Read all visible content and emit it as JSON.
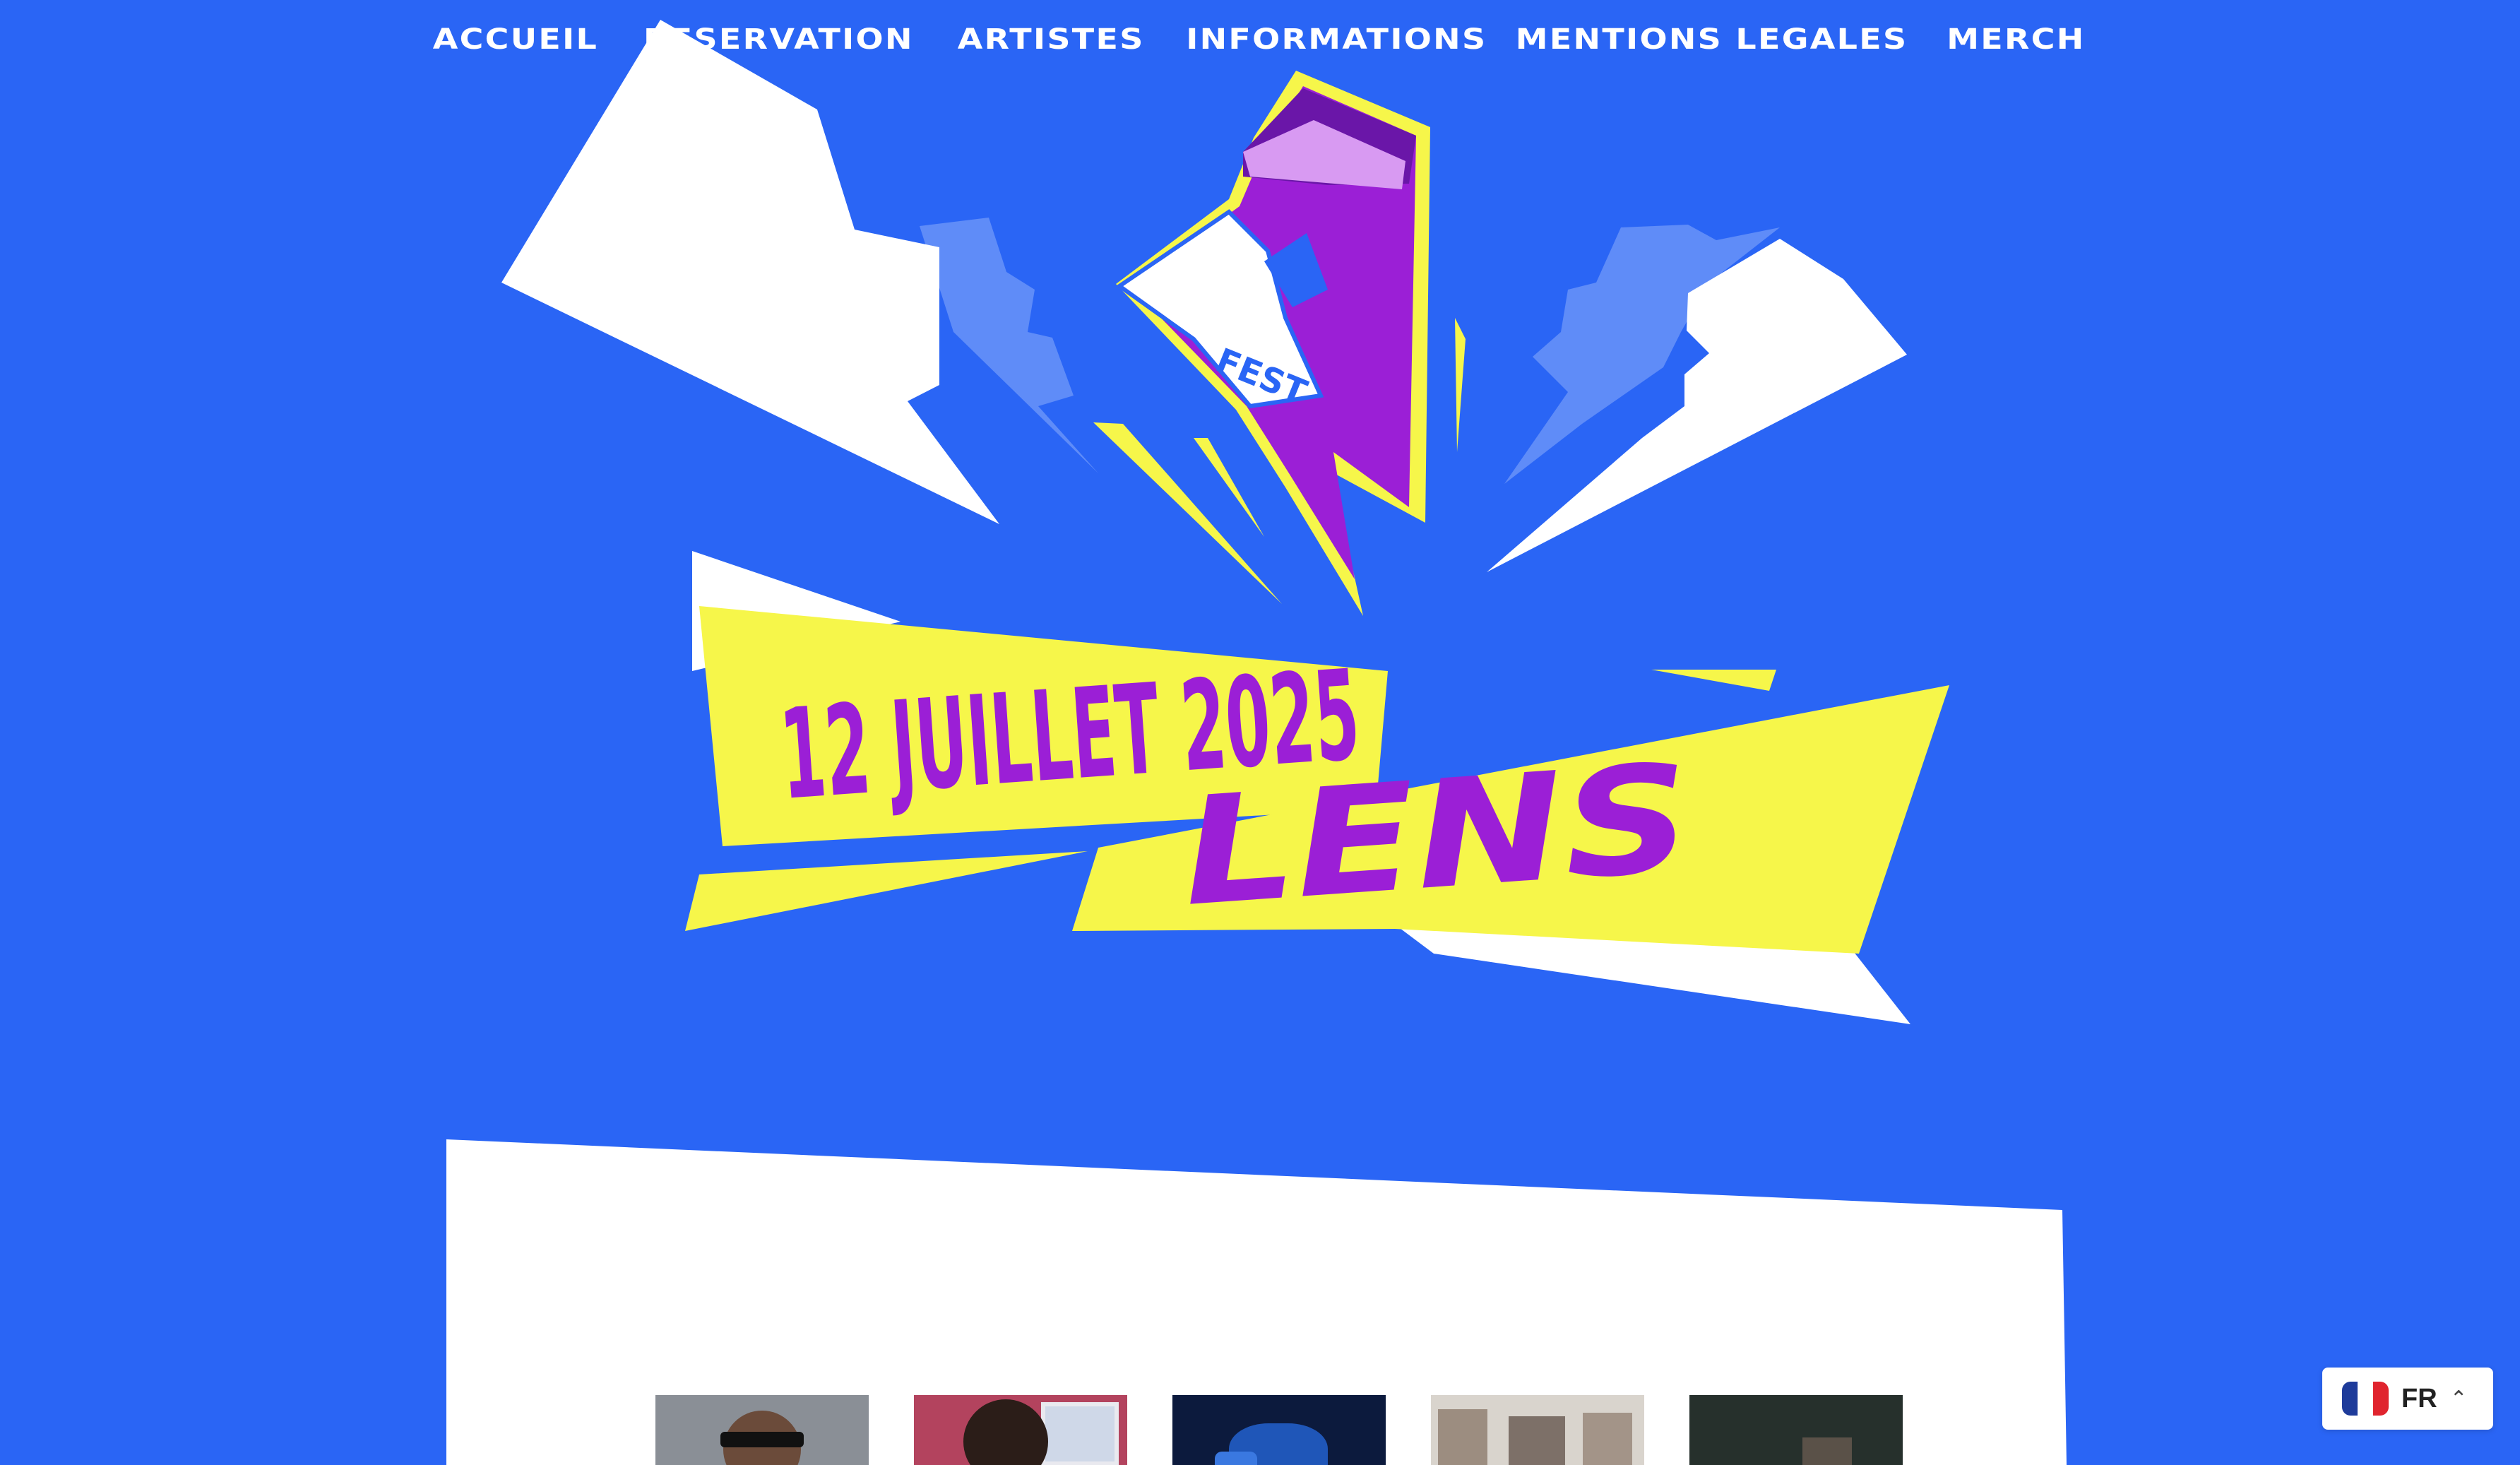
{
  "nav": {
    "items": [
      {
        "label": "ACCUEIL"
      },
      {
        "label": "RESERVATION"
      },
      {
        "label": "ARTISTES"
      },
      {
        "label": "INFORMATIONS"
      },
      {
        "label": "MENTIONS LEGALES"
      },
      {
        "label": "MERCH"
      }
    ]
  },
  "hero": {
    "logo_text": "FEST",
    "date": "12 JUILLET 2025",
    "city": "LENS"
  },
  "language": {
    "code": "FR",
    "flag": "france-flag",
    "chevron": "chevron-up-icon"
  },
  "colors": {
    "background": "#2a65f5",
    "yellow": "#f6f64a",
    "purple": "#9b1fd6",
    "white": "#ffffff"
  }
}
